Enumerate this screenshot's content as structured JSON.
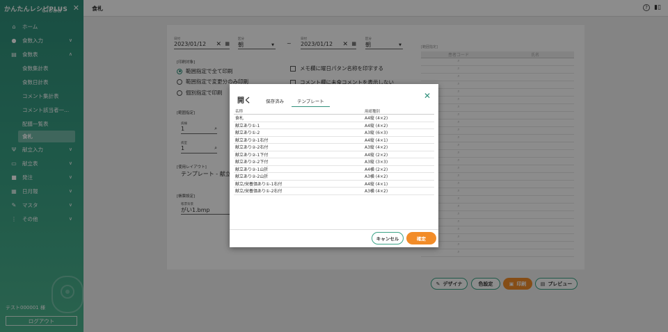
{
  "sidebar": {
    "logo": "かんたんレシピPLUS",
    "logo_sub": "Cloud",
    "items": [
      {
        "label": "ホーム",
        "icon": "home-icon"
      },
      {
        "label": "食数入力",
        "icon": "person-icon"
      },
      {
        "label": "食数表",
        "icon": "document-icon"
      },
      {
        "label": "献立入力",
        "icon": "fork-knife-icon"
      },
      {
        "label": "献立表",
        "icon": "monitor-icon"
      },
      {
        "label": "発注",
        "icon": "truck-icon"
      },
      {
        "label": "日月報",
        "icon": "calendar-icon"
      },
      {
        "label": "マスタ",
        "icon": "wrench-icon"
      },
      {
        "label": "その他",
        "icon": "more-icon"
      }
    ],
    "sub_items": [
      "食数集計表",
      "食数日計表",
      "コメント集計表",
      "コメント該当者一...",
      "配膳一覧表",
      "食札"
    ],
    "user": "テスト000001 様",
    "logout": "ログアウト"
  },
  "header": {
    "title": "食札"
  },
  "form": {
    "from_date_label": "日付",
    "from_date": "2023/01/12",
    "from_kubun_label": "区分",
    "from_kubun": "朝",
    "tilde": "~",
    "to_date_label": "日付",
    "to_date": "2023/01/12",
    "to_kubun_label": "区分",
    "to_kubun": "朝",
    "print_target_label": "[印刷対象]",
    "radio1": "範囲指定で全て印刷",
    "radio2": "範囲指定で変更分のみ印刷",
    "radio3": "個別指定で印刷",
    "check1": "メモ欄に曜日パタン名称を印字する",
    "check2": "コメント欄に未食コメントを表示しない",
    "range_label": "[範囲指定]",
    "ward_label": "病棟",
    "ward_from": "1",
    "room_label": "病室",
    "room_from": "1",
    "layout_label": "[使用レイアウト]",
    "layout_value": "テンプレート - 献立",
    "bg_label": "[帳票設定]",
    "bg_sub_label": "帳票背景",
    "bg_value": "がい1.bmp",
    "right_label": "[範囲指定]",
    "right_col1": "患者コード",
    "right_col2": "氏名"
  },
  "actions": {
    "designer": "デザイナ",
    "color": "色設定",
    "print": "印刷",
    "preview": "プレビュー"
  },
  "dialog": {
    "title": "開く",
    "tabs": [
      "保存済み",
      "テンプレート"
    ],
    "col_name": "名称",
    "col_paper": "用紙種別",
    "rows": [
      {
        "name": "食札",
        "paper": "A4縦 (4×2)"
      },
      {
        "name": "献立あり①-1",
        "paper": "A4縦 (4×2)"
      },
      {
        "name": "献立あり①-2",
        "paper": "A3縦 (6×3)"
      },
      {
        "name": "献立あり②-1右付",
        "paper": "A4縦 (4×1)"
      },
      {
        "name": "献立あり②-2右付",
        "paper": "A3縦 (4×2)"
      },
      {
        "name": "献立あり②-1下付",
        "paper": "A4縦 (2×2)"
      },
      {
        "name": "献立あり②-2下付",
        "paper": "A3縦 (3×3)"
      },
      {
        "name": "献立あり②-1山折",
        "paper": "A4横 (2×2)"
      },
      {
        "name": "献立あり②-2山折",
        "paper": "A3横 (4×2)"
      },
      {
        "name": "献立/栄養価あり①-1右付",
        "paper": "A4縦 (4×1)"
      },
      {
        "name": "献立/栄養価あり①-2右付",
        "paper": "A3横 (4×2)"
      }
    ],
    "cancel": "キャンセル",
    "ok": "確定"
  }
}
